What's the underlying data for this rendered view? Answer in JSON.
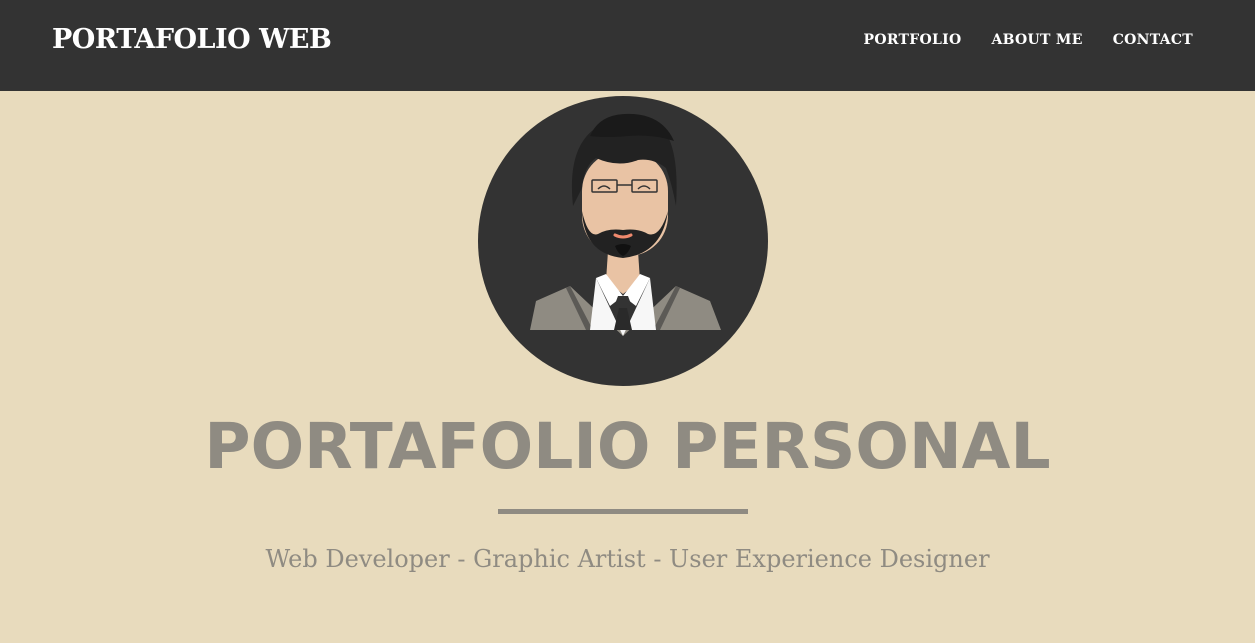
{
  "nav": {
    "brand": "PORTAFOLIO WEB",
    "links": [
      "PORTFOLIO",
      "ABOUT ME",
      "CONTACT"
    ]
  },
  "hero": {
    "avatar_icon": "profile-avatar-icon",
    "title": "PORTAFOLIO PERSONAL",
    "subtitle": "Web Developer - Graphic Artist - User Experience Designer"
  },
  "colors": {
    "navbar_bg": "#333333",
    "page_bg": "#e8dbbd",
    "title_text": "#8f8b82",
    "avatar_bg": "#333333"
  }
}
